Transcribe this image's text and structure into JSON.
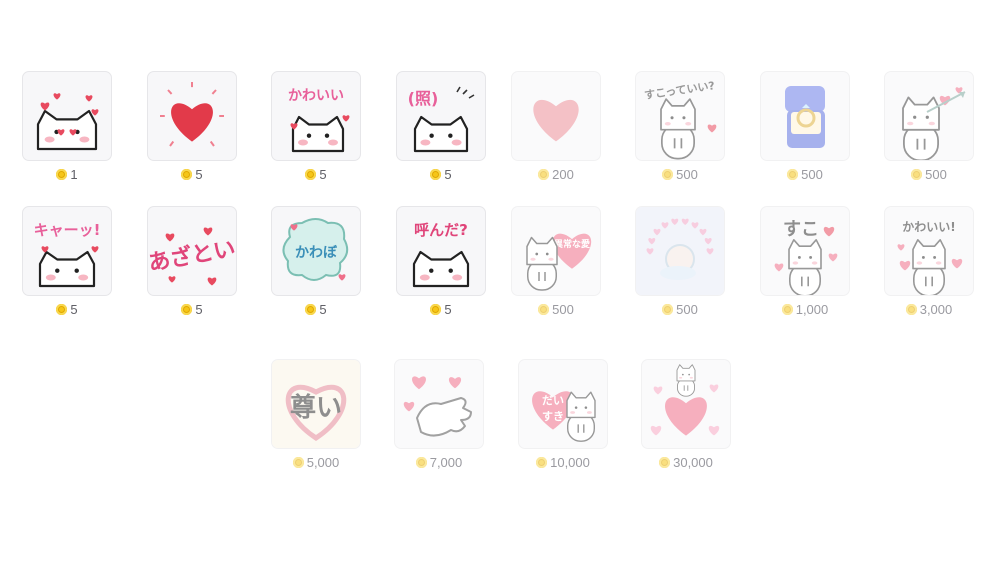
{
  "colors": {
    "coin": "#f5c518",
    "heart": "#e84a5f",
    "pink": "#ef6f8a",
    "text": "#5f5f66"
  },
  "gifts": [
    {
      "name": "cat-hearts-gift",
      "icon": "cat-with-hearts-icon",
      "price": "1"
    },
    {
      "name": "red-heart-gift",
      "icon": "red-heart-icon",
      "price": "5"
    },
    {
      "name": "kawaii-cat-gift",
      "icon": "kawaii-text-cat-icon",
      "text": "かわいい",
      "price": "5"
    },
    {
      "name": "shy-cat-gift",
      "icon": "shy-cat-icon",
      "text": "(照)",
      "price": "5"
    },
    {
      "name": "pink-heart-gift",
      "icon": "pink-heart-icon",
      "price": "200"
    },
    {
      "name": "suki-cat-gift",
      "icon": "suki-cat-icon",
      "text": "すこっていい?",
      "price": "500"
    },
    {
      "name": "ring-box-gift",
      "icon": "ring-box-icon",
      "price": "500"
    },
    {
      "name": "cupid-cat-gift",
      "icon": "cupid-arrow-cat-icon",
      "price": "500"
    },
    {
      "name": "kyaa-cat-gift",
      "icon": "kyaa-cat-icon",
      "text": "キャーッ!",
      "price": "5"
    },
    {
      "name": "azatoi-gift",
      "icon": "azatoi-text-icon",
      "text": "あざとい",
      "price": "5"
    },
    {
      "name": "kawabo-gift",
      "icon": "kawabo-bubble-icon",
      "text": "かわぼ",
      "price": "5"
    },
    {
      "name": "yonda-cat-gift",
      "icon": "yonda-cat-icon",
      "text": "呼んだ?",
      "price": "5"
    },
    {
      "name": "love-heart-cat-gift",
      "icon": "love-heart-cat-icon",
      "text": "異常な愛",
      "price": "500"
    },
    {
      "name": "heart-wreath-gift",
      "icon": "heart-wreath-icon",
      "price": "500"
    },
    {
      "name": "suko-cat-gift",
      "icon": "suko-cat-icon",
      "text": "すこ",
      "price": "1,000"
    },
    {
      "name": "kawaii-excl-cat-gift",
      "icon": "kawaii-cat-hearts-icon",
      "text": "かわいい!",
      "price": "3,000"
    },
    {
      "name": "toutoi-heart-gift",
      "icon": "toutoi-heart-icon",
      "text": "尊い",
      "price": "5,000"
    },
    {
      "name": "hand-hearts-gift",
      "icon": "hand-hearts-icon",
      "price": "7,000"
    },
    {
      "name": "daisuki-cat-gift",
      "icon": "daisuki-cat-icon",
      "text": "だいすき",
      "price": "10,000"
    },
    {
      "name": "big-heart-cat-gift",
      "icon": "big-heart-cat-icon",
      "price": "30,000"
    }
  ]
}
